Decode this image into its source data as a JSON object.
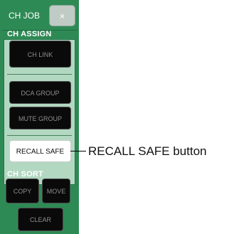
{
  "window": {
    "title": "CH JOB",
    "close_label": "×"
  },
  "ch_assign": {
    "label": "CH ASSIGN",
    "buttons": {
      "ch_link": "CH LINK",
      "dca_group": "DCA GROUP",
      "mute_group": "MUTE GROUP",
      "recall_safe": "RECALL SAFE"
    }
  },
  "ch_sort": {
    "label": "CH SORT",
    "buttons": {
      "copy": "COPY",
      "move": "MOVE",
      "clear": "CLEAR"
    }
  },
  "annotation": {
    "text": "RECALL SAFE button"
  }
}
